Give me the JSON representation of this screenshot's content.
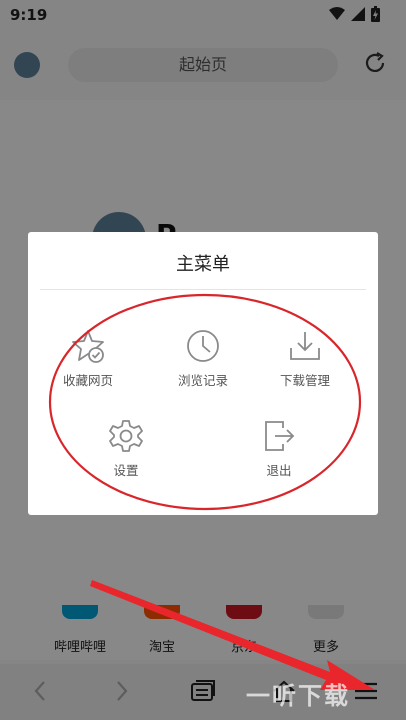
{
  "status": {
    "time": "9:19"
  },
  "browser": {
    "address_text": "起始页"
  },
  "home": {
    "brand_partial": "P",
    "shortcuts": [
      {
        "label": "哔哩哔哩",
        "color": "#00a1d6"
      },
      {
        "label": "淘宝",
        "color": "#ff5000"
      },
      {
        "label": "京东",
        "color": "#c81623"
      },
      {
        "label": "更多",
        "color": "#dddddd"
      }
    ]
  },
  "menu": {
    "title": "主菜单",
    "items": [
      {
        "label": "收藏网页",
        "icon": "star-check-icon"
      },
      {
        "label": "浏览记录",
        "icon": "clock-icon"
      },
      {
        "label": "下载管理",
        "icon": "download-icon"
      },
      {
        "label": "设置",
        "icon": "gear-icon"
      },
      {
        "label": "退出",
        "icon": "exit-icon"
      }
    ]
  },
  "annotation": {
    "color": "#d8262b"
  },
  "watermark": {
    "text": "一听下载"
  }
}
